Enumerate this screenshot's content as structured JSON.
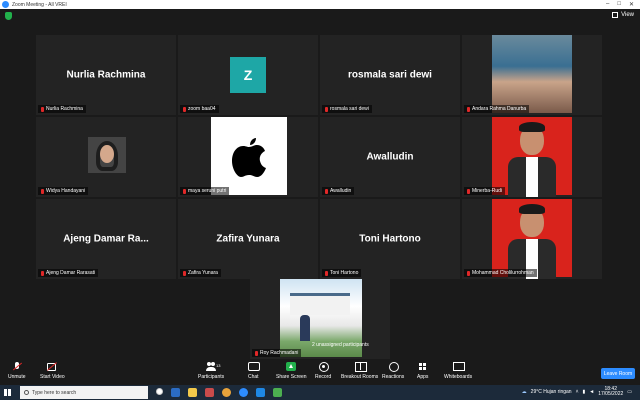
{
  "window": {
    "title": "Zoom Meeting - All VREI"
  },
  "topbar": {
    "view_label": "View"
  },
  "tiles": [
    {
      "display_name": "Nurlia Rachmina",
      "label": "Nurlia Rachmina"
    },
    {
      "avatar_letter": "Z",
      "label": "zoom baa04"
    },
    {
      "display_name": "rosmala sari dewi",
      "label": "rosmala sari dewi"
    },
    {
      "label": "Andara Rahma Danurba"
    },
    {
      "label": "Widya Handayani"
    },
    {
      "label": "maya seruni putri"
    },
    {
      "display_name": "Awalludin",
      "label": "Awalludin"
    },
    {
      "label": "Minerba-Rudi"
    },
    {
      "display_name": "Ajeng Damar Ra...",
      "label": "Ajeng Damar Rarasati"
    },
    {
      "display_name": "Zafira Yunara",
      "label": "Zafira Yunara"
    },
    {
      "display_name": "Toni Hartono",
      "label": "Toni Hartono"
    },
    {
      "label": "Mohammad Cholilurrohman"
    },
    {
      "label": "Roy Rachmadani"
    }
  ],
  "unassigned": "2 unassigned participants",
  "toolbar": {
    "unmute": "Unmute",
    "start_video": "Start Video",
    "participants": "Participants",
    "participants_count": "13",
    "chat": "Chat",
    "share_screen": "Share Screen",
    "record": "Record",
    "breakout_rooms": "Breakout Rooms",
    "reactions": "Reactions",
    "apps": "Apps",
    "whiteboards": "Whiteboards",
    "leave": "Leave Room"
  },
  "taskbar": {
    "search_placeholder": "Type here to search",
    "weather": "29°C  Hujan ringan",
    "time": "18:42",
    "date": "17/05/2022"
  },
  "colors": {
    "accent": "#2d8cff",
    "share_green": "#22b14c",
    "avatar_teal": "#1ea7a6",
    "muted_red": "#e02828"
  }
}
